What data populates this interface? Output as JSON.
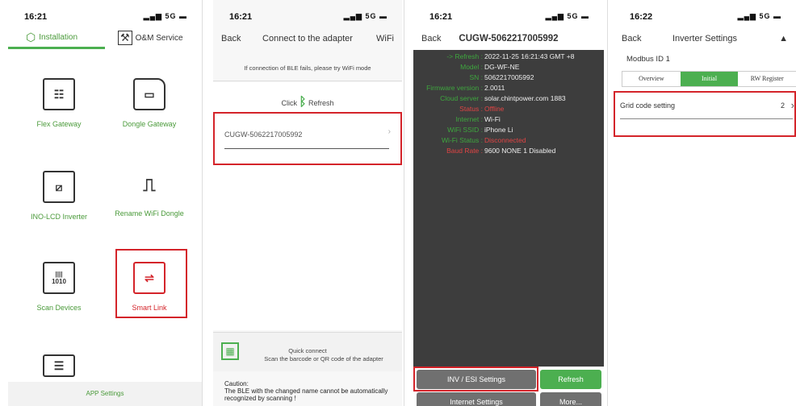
{
  "screen1": {
    "time": "16:21",
    "signal": "5G",
    "tabs": {
      "installation": "Installation",
      "om_service": "O&M Service"
    },
    "tiles": [
      {
        "label": "Flex Gateway"
      },
      {
        "label": "Dongle Gateway"
      },
      {
        "label": "INO-LCD Inverter"
      },
      {
        "label": "Rename WiFi Dongle"
      },
      {
        "label": "Scan Devices"
      },
      {
        "label": "Smart Link"
      }
    ],
    "scan_icon_text": "1010",
    "footer": "APP Settings"
  },
  "screen2": {
    "time": "16:21",
    "signal": "5G",
    "back": "Back",
    "title": "Connect to the adapter",
    "wifi": "WiFi",
    "hint": "If connection of BLE fails, please try WiFi mode",
    "click": "Click",
    "refresh": "Refresh",
    "device": "CUGW-5062217005992",
    "quick_title": "Quick connect",
    "quick_desc": "Scan the barcode or QR code of the adapter",
    "caution_title": "Caution:",
    "caution_text": "The BLE with the changed name cannot be automatically recognized by scanning !"
  },
  "screen3": {
    "time": "16:21",
    "signal": "5G",
    "back": "Back",
    "title": "CUGW-5062217005992",
    "rows": [
      {
        "k": "-> Refresh :",
        "v": "2022-11-25 16:21:43 GMT +8"
      },
      {
        "k": "Model :",
        "v": "DG-WF-NE"
      },
      {
        "k": "SN :",
        "v": "5062217005992"
      },
      {
        "k": "Firmware version :",
        "v": "2.0011"
      },
      {
        "k": "Cloud server :",
        "v": "solar.chintpower.com 1883"
      },
      {
        "k": "Status :",
        "v": "Offline"
      },
      {
        "k": "Internet :",
        "v": "Wi-Fi"
      },
      {
        "k": "WiFi SSID :",
        "v": "iPhone Li"
      },
      {
        "k": "Wi-Fi Status :",
        "v": "Disconnected"
      },
      {
        "k": "Baud Rate :",
        "v": "9600 NONE 1 Disabled"
      }
    ],
    "btn_inv": "INV / ESI Settings",
    "btn_refresh": "Refresh",
    "btn_internet": "Internet Settings",
    "btn_more": "More...",
    "colors": {
      "green_text": "#3ea63e",
      "red_text": "#e04444",
      "terminal_bg": "#3d3d3d",
      "refresh_btn": "#4caf50"
    }
  },
  "screen4": {
    "time": "16:22",
    "signal": "5G",
    "back": "Back",
    "title": "Inverter Settings",
    "modbus": "Modbus ID 1",
    "seg": [
      "Overview",
      "Initial",
      "RW Register"
    ],
    "row_label": "Grid code setting",
    "row_value": "2"
  },
  "colors": {
    "accent": "#4caf50",
    "highlight_box": "#d4242a"
  }
}
